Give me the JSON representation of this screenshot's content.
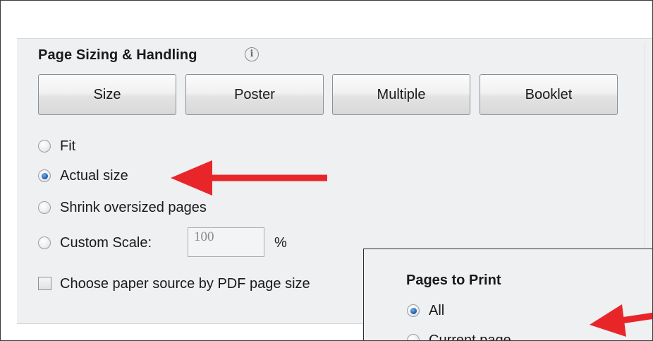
{
  "section": {
    "title": "Page Sizing & Handling",
    "info_icon": "info-icon"
  },
  "buttons": {
    "size": "Size",
    "poster": "Poster",
    "multiple": "Multiple",
    "booklet": "Booklet"
  },
  "options": {
    "fit": "Fit",
    "actual_size": "Actual size",
    "shrink": "Shrink oversized pages",
    "custom_scale": "Custom Scale:",
    "selected": "Actual size"
  },
  "custom_scale": {
    "value": "100",
    "unit": "%"
  },
  "checkbox": {
    "label": "Choose paper source by PDF page size",
    "checked": false
  },
  "pages_to_print": {
    "title": "Pages to Print",
    "all": "All",
    "current_page": "Current page",
    "selected": "All"
  },
  "colors": {
    "arrow": "#e8262a",
    "panel_bg": "#eef0f2"
  }
}
